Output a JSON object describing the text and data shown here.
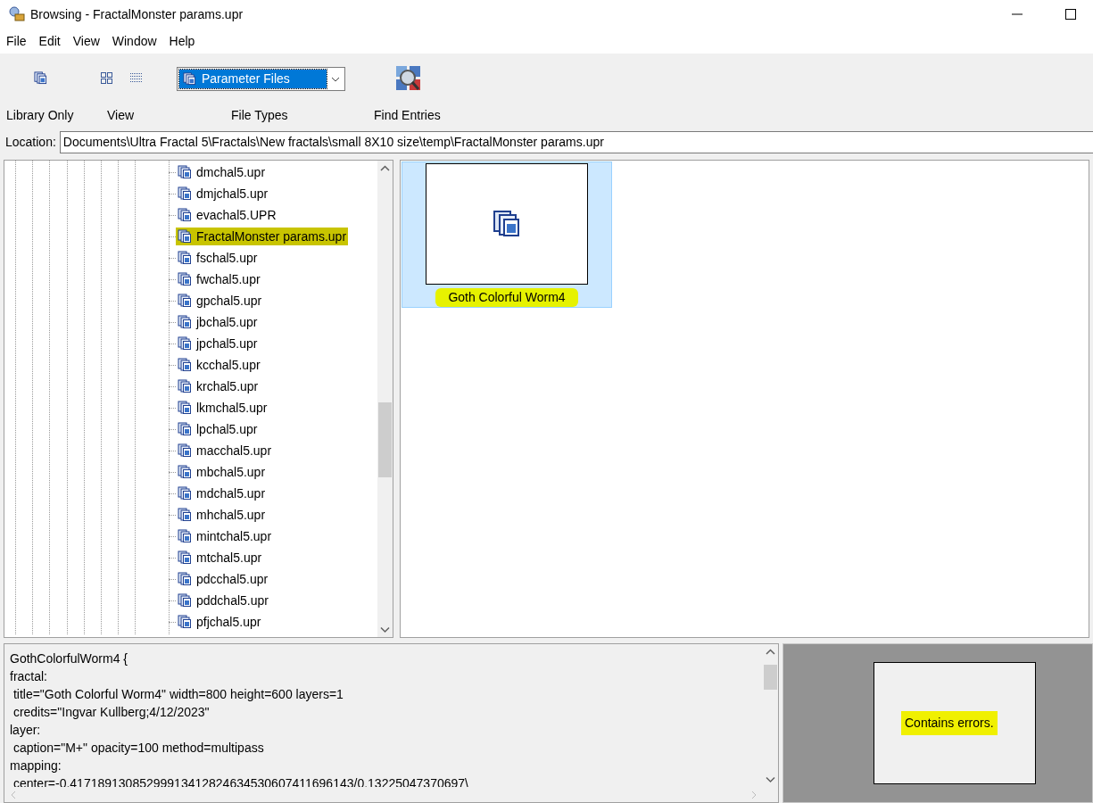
{
  "window": {
    "title": "Browsing - FractalMonster params.upr"
  },
  "menu": [
    "File",
    "Edit",
    "View",
    "Window",
    "Help"
  ],
  "toolbar": {
    "library_only": {
      "label": "Library Only"
    },
    "view": {
      "label": "View"
    },
    "file_types": {
      "label": "File Types",
      "value": "Parameter Files"
    },
    "find_entries": {
      "label": "Find Entries"
    }
  },
  "location": {
    "label": "Location:",
    "value": "Documents\\Ultra Fractal 5\\Fractals\\New fractals\\small 8X10 size\\temp\\FractalMonster params.upr"
  },
  "tree": {
    "items": [
      {
        "label": "dmchal5.upr",
        "selected": false
      },
      {
        "label": "dmjchal5.upr",
        "selected": false
      },
      {
        "label": "evachal5.UPR",
        "selected": false
      },
      {
        "label": "FractalMonster params.upr",
        "selected": true
      },
      {
        "label": "fschal5.upr",
        "selected": false
      },
      {
        "label": "fwchal5.upr",
        "selected": false
      },
      {
        "label": "gpchal5.upr",
        "selected": false
      },
      {
        "label": "jbchal5.upr",
        "selected": false
      },
      {
        "label": "jpchal5.upr",
        "selected": false
      },
      {
        "label": "kcchal5.upr",
        "selected": false
      },
      {
        "label": "krchal5.upr",
        "selected": false
      },
      {
        "label": "lkmchal5.upr",
        "selected": false
      },
      {
        "label": "lpchal5.upr",
        "selected": false
      },
      {
        "label": "macchal5.upr",
        "selected": false
      },
      {
        "label": "mbchal5.upr",
        "selected": false
      },
      {
        "label": "mdchal5.upr",
        "selected": false
      },
      {
        "label": "mhchal5.upr",
        "selected": false
      },
      {
        "label": "mintchal5.upr",
        "selected": false
      },
      {
        "label": "mtchal5.upr",
        "selected": false
      },
      {
        "label": "pdcchal5.upr",
        "selected": false
      },
      {
        "label": "pddchal5.upr",
        "selected": false
      },
      {
        "label": "pfjchal5.upr",
        "selected": false
      }
    ]
  },
  "entries": [
    {
      "label": "Goth Colorful Worm4",
      "selected": true
    }
  ],
  "source_text": [
    "GothColorfulWorm4 {",
    "fractal:",
    " title=\"Goth Colorful Worm4\" width=800 height=600 layers=1",
    " credits=\"Ingvar Kullberg;4/12/2023\"",
    "layer:",
    " caption=\"M+\" opacity=100 method=multipass",
    "mapping:",
    " center=-0.41718913085299913412824634530607411696143/0.13225047370697\\"
  ],
  "preview": {
    "message": "Contains errors."
  }
}
